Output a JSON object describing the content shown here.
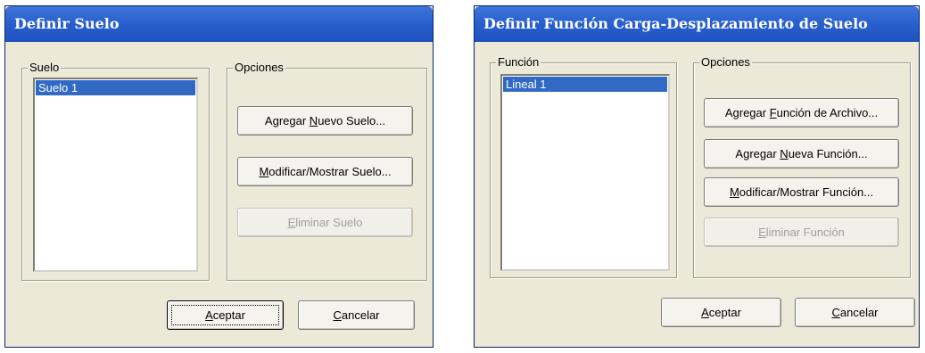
{
  "dialog1": {
    "title": "Definir Suelo",
    "list_group_label": "Suelo",
    "list_items": [
      "Suelo 1"
    ],
    "options_label": "Opciones",
    "btn_add": {
      "pre": "Agregar ",
      "key": "N",
      "post": "uevo Suelo..."
    },
    "btn_modify": {
      "pre": "",
      "key": "M",
      "post": "odificar/Mostrar Suelo..."
    },
    "btn_delete": {
      "pre": "",
      "key": "E",
      "post": "liminar Suelo"
    },
    "btn_ok": {
      "pre": "",
      "key": "A",
      "post": "ceptar"
    },
    "btn_cancel": {
      "pre": "",
      "key": "C",
      "post": "ancelar"
    }
  },
  "dialog2": {
    "title": "Definir Función Carga-Desplazamiento de Suelo",
    "list_group_label": "Función",
    "list_items": [
      "Lineal 1"
    ],
    "options_label": "Opciones",
    "btn_add_file": {
      "pre": "Agregar ",
      "key": "F",
      "post": "unción de Archivo..."
    },
    "btn_add_new": {
      "pre": "Agregar ",
      "key": "N",
      "post": "ueva Función..."
    },
    "btn_modify": {
      "pre": "",
      "key": "M",
      "post": "odificar/Mostrar Función..."
    },
    "btn_delete": {
      "pre": "",
      "key": "E",
      "post": "liminar Función"
    },
    "btn_ok": {
      "pre": "",
      "key": "A",
      "post": "ceptar"
    },
    "btn_cancel": {
      "pre": "",
      "key": "C",
      "post": "ancelar"
    }
  },
  "colors": {
    "titlebar": "#2961cf",
    "dialog_bg": "#ece9d8",
    "selection": "#316ac5"
  }
}
